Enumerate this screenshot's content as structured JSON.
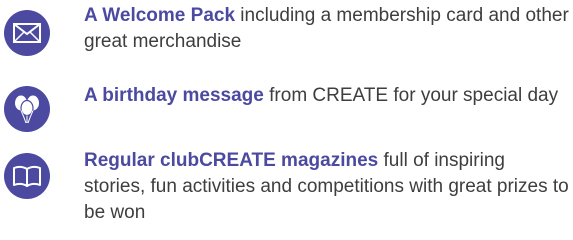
{
  "colors": {
    "accent": "#4b4aa0",
    "body_text": "#3e3e3e",
    "icon_glyph": "#ffffff"
  },
  "benefits": [
    {
      "icon": "envelope-icon",
      "title": "A Welcome Pack",
      "description": " including a membership card and other great merchandise"
    },
    {
      "icon": "balloons-icon",
      "title": "A birthday message",
      "description": " from CREATE for your special day"
    },
    {
      "icon": "book-icon",
      "title": "Regular clubCREATE magazines",
      "description": " full of inspiring stories, fun activities and competitions with great prizes to be won"
    }
  ]
}
